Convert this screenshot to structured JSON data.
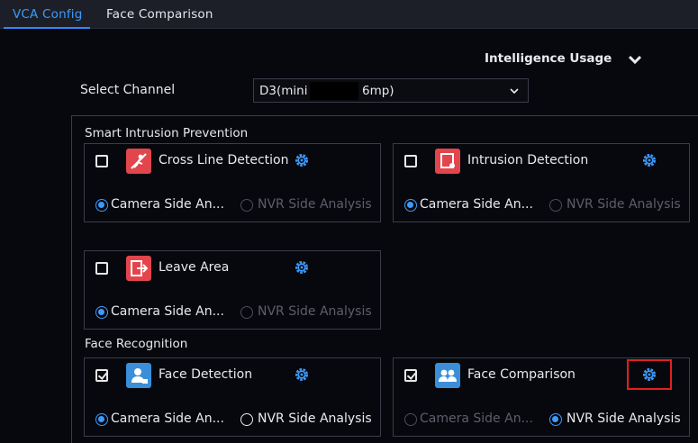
{
  "tabs": [
    {
      "label": "VCA Config",
      "active": true
    },
    {
      "label": "Face Comparison",
      "active": false
    }
  ],
  "intelligence_usage": {
    "label": "Intelligence Usage"
  },
  "select_channel": {
    "label": "Select Channel",
    "value_prefix": "D3(mini",
    "value_suffix": "6mp)"
  },
  "groups": {
    "smart_intrusion": "Smart Intrusion Prevention",
    "face_recognition": "Face Recognition"
  },
  "cards": [
    {
      "name": "Cross Line Detection",
      "checked": false,
      "camera_label": "Camera Side An...",
      "nvr_label": "NVR Side Analysis",
      "selected": "camera",
      "nvr_enabled": false
    },
    {
      "name": "Intrusion Detection",
      "checked": false,
      "camera_label": "Camera Side An...",
      "nvr_label": "NVR Side Analysis",
      "selected": "camera",
      "nvr_enabled": false
    },
    {
      "name": "Leave Area",
      "checked": false,
      "camera_label": "Camera Side An...",
      "nvr_label": "NVR Side Analysis",
      "selected": "camera",
      "nvr_enabled": false
    },
    {
      "name": "Face Detection",
      "checked": true,
      "camera_label": "Camera Side An...",
      "nvr_label": "NVR Side Analysis",
      "selected": "camera",
      "nvr_enabled": true
    },
    {
      "name": "Face Comparison",
      "checked": true,
      "camera_label": "Camera Side An...",
      "nvr_label": "NVR Side Analysis",
      "selected": "nvr",
      "camera_enabled": false
    }
  ],
  "colors": {
    "accent": "#3d9bff",
    "highlight": "#e02020",
    "icon_red": "#e2454c",
    "icon_blue": "#3a8fd8"
  }
}
